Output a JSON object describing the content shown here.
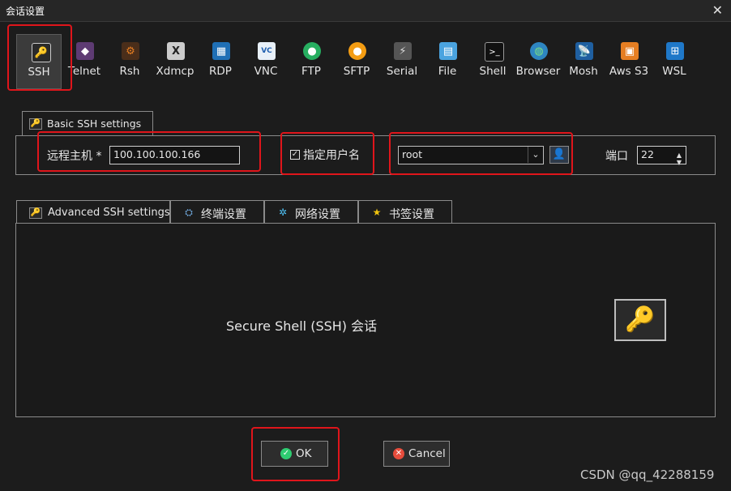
{
  "window": {
    "title": "会话设置",
    "close_glyph": "✕"
  },
  "toolbar": [
    {
      "label": "SSH",
      "icon": "ssh-key-icon",
      "color": "#f1c40f",
      "active": true
    },
    {
      "label": "Telnet",
      "icon": "telnet-icon",
      "color": "#9b59b6"
    },
    {
      "label": "Rsh",
      "icon": "rsh-icon",
      "color": "#e67e22"
    },
    {
      "label": "Xdmcp",
      "icon": "xdmcp-icon",
      "color": "#dddddd"
    },
    {
      "label": "RDP",
      "icon": "rdp-icon",
      "color": "#3498db"
    },
    {
      "label": "VNC",
      "icon": "vnc-icon",
      "color": "#2980b9"
    },
    {
      "label": "FTP",
      "icon": "ftp-icon",
      "color": "#2ecc71"
    },
    {
      "label": "SFTP",
      "icon": "sftp-icon",
      "color": "#f39c12"
    },
    {
      "label": "Serial",
      "icon": "serial-icon",
      "color": "#aaaaaa"
    },
    {
      "label": "File",
      "icon": "file-icon",
      "color": "#4aa3df"
    },
    {
      "label": "Shell",
      "icon": "shell-icon",
      "color": "#444444"
    },
    {
      "label": "Browser",
      "icon": "browser-icon",
      "color": "#27ae60"
    },
    {
      "label": "Mosh",
      "icon": "mosh-icon",
      "color": "#2c8bd6"
    },
    {
      "label": "Aws S3",
      "icon": "aws-s3-icon",
      "color": "#f39c12"
    },
    {
      "label": "WSL",
      "icon": "wsl-icon",
      "color": "#3498db"
    }
  ],
  "basic": {
    "tab_label": "Basic SSH settings",
    "remote_host_label": "远程主机 *",
    "remote_host_value": "100.100.100.166",
    "specify_user_label": "指定用户名",
    "specify_user_checked": true,
    "username_value": "root",
    "port_label": "端口",
    "port_value": "22"
  },
  "tabs": [
    {
      "label": "Advanced SSH settings",
      "icon": "key-icon"
    },
    {
      "label": "终端设置",
      "icon": "terminal-icon"
    },
    {
      "label": "网络设置",
      "icon": "network-icon"
    },
    {
      "label": "书签设置",
      "icon": "star-icon"
    }
  ],
  "panel": {
    "description": "Secure Shell (SSH) 会话"
  },
  "buttons": {
    "ok": "OK",
    "cancel": "Cancel"
  },
  "watermark": "CSDN @qq_42288159",
  "colors": {
    "highlight_red": "#e0151b",
    "ok_green": "#2ecc71",
    "cancel_red": "#e74c3c",
    "background": "#1c1c1c"
  }
}
